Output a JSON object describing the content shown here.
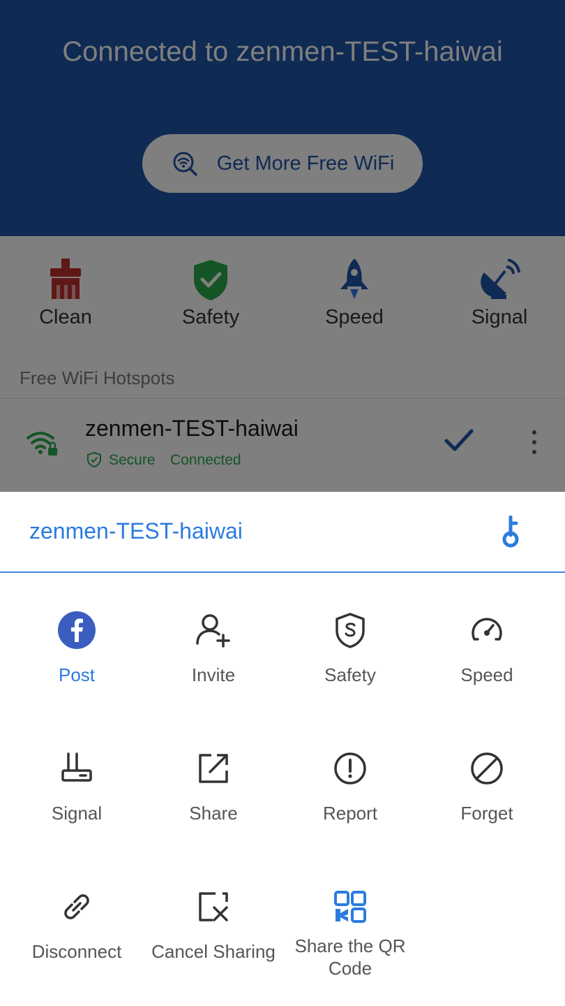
{
  "hero": {
    "title": "Connected to zenmen-TEST-haiwai",
    "more_wifi_button": "Get More Free WiFi"
  },
  "tools": [
    {
      "label": "Clean",
      "icon": "broom-icon"
    },
    {
      "label": "Safety",
      "icon": "shield-check-icon"
    },
    {
      "label": "Speed",
      "icon": "rocket-icon"
    },
    {
      "label": "Signal",
      "icon": "satellite-dish-icon"
    }
  ],
  "hotspots": {
    "section_title": "Free WiFi Hotspots",
    "items": [
      {
        "name": "zenmen-TEST-haiwai",
        "security": "Secure",
        "status": "Connected"
      }
    ]
  },
  "sheet": {
    "title": "zenmen-TEST-haiwai",
    "actions": [
      {
        "label": "Post",
        "icon": "facebook-icon",
        "active": true
      },
      {
        "label": "Invite",
        "icon": "add-user-icon"
      },
      {
        "label": "Safety",
        "icon": "shield-s-icon"
      },
      {
        "label": "Speed",
        "icon": "speedometer-icon"
      },
      {
        "label": "Signal",
        "icon": "router-icon"
      },
      {
        "label": "Share",
        "icon": "share-external-icon"
      },
      {
        "label": "Report",
        "icon": "exclamation-circle-icon"
      },
      {
        "label": "Forget",
        "icon": "block-icon"
      },
      {
        "label": "Disconnect",
        "icon": "broken-link-icon"
      },
      {
        "label": "Cancel Sharing",
        "icon": "cancel-share-icon"
      },
      {
        "label": "Share the QR Code",
        "icon": "qr-code-icon"
      }
    ]
  },
  "colors": {
    "brand_blue": "#1e55a6",
    "accent_blue": "#2b7be0",
    "success_green": "#2aa84a",
    "facebook_blue": "#3b5dbf"
  }
}
